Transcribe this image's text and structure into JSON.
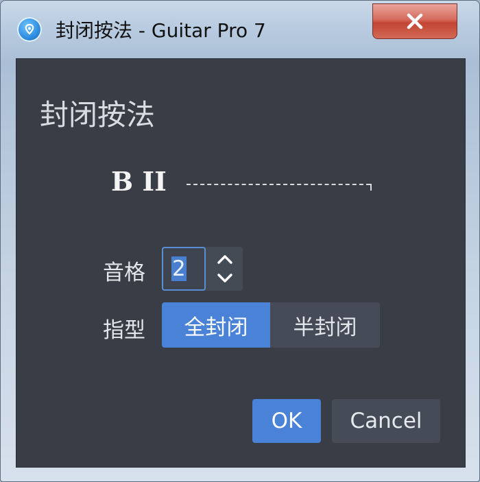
{
  "window": {
    "title": "封闭按法 - Guitar Pro 7"
  },
  "dialog": {
    "heading": "封闭按法",
    "barre_notation": "B II",
    "fret": {
      "label": "音格",
      "value": "2"
    },
    "finger_type": {
      "label": "指型",
      "options": [
        "全封闭",
        "半封闭"
      ],
      "selected": "全封闭"
    },
    "buttons": {
      "ok": "OK",
      "cancel": "Cancel"
    }
  },
  "colors": {
    "dialog_background": "#383d46",
    "accent": "#4a82d8",
    "close_button": "#c24434"
  },
  "icons": {
    "app": "guitar-pro-icon",
    "close": "close-icon",
    "spin_up": "chevron-up-icon",
    "spin_down": "chevron-down-icon"
  }
}
